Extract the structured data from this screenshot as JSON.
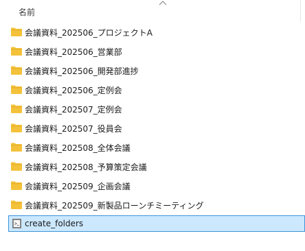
{
  "header": {
    "name_label": "名前"
  },
  "colors": {
    "folder_yellow": "#f4c23a",
    "folder_shade": "#dba520",
    "selection_bg": "#cce8ff",
    "selection_border": "#3b94d9"
  },
  "icons": {
    "sort": "chevron-up-icon",
    "folder": "folder-icon",
    "file": "script-file-icon"
  },
  "folders": [
    {
      "name": "会議資料_202506_プロジェクトA"
    },
    {
      "name": "会議資料_202506_営業部"
    },
    {
      "name": "会議資料_202506_開発部進捗"
    },
    {
      "name": "会議資料_202506_定例会"
    },
    {
      "name": "会議資料_202507_定例会"
    },
    {
      "name": "会議資料_202507_役員会"
    },
    {
      "name": "会議資料_202508_全体会議"
    },
    {
      "name": "会議資料_202508_予算策定会議"
    },
    {
      "name": "会議資料_202509_企画会議"
    },
    {
      "name": "会議資料_202509_新製品ローンチミーティング"
    }
  ],
  "selected_file": {
    "name": "create_folders"
  }
}
